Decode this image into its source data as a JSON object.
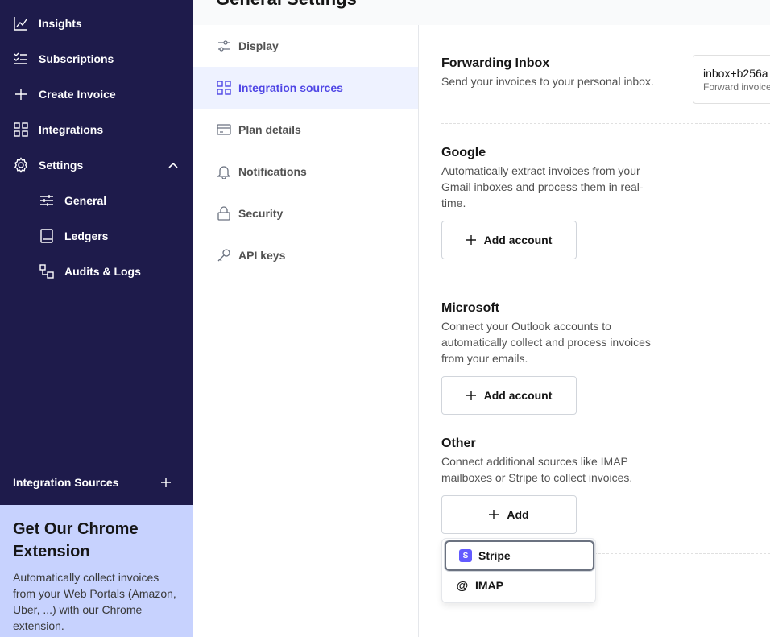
{
  "sidebar": {
    "nav": [
      {
        "label": "Insights",
        "icon": "chart-line-icon"
      },
      {
        "label": "Subscriptions",
        "icon": "checklist-icon"
      },
      {
        "label": "Create Invoice",
        "icon": "plus-icon"
      },
      {
        "label": "Integrations",
        "icon": "grid-icon"
      },
      {
        "label": "Settings",
        "icon": "gear-icon"
      }
    ],
    "settings_sub": [
      {
        "label": "General",
        "icon": "sliders-icon"
      },
      {
        "label": "Ledgers",
        "icon": "book-icon"
      },
      {
        "label": "Audits & Logs",
        "icon": "flow-icon"
      }
    ],
    "integration_sources_label": "Integration Sources",
    "promo": {
      "title": "Get Our Chrome Extension",
      "body": "Automatically collect invoices from your Web Portals (Amazon, Uber, ...) with our Chrome extension."
    }
  },
  "header": {
    "title": "General Settings"
  },
  "settings_menu": [
    {
      "label": "Display",
      "icon": "sliders-icon"
    },
    {
      "label": "Integration sources",
      "icon": "grid-icon"
    },
    {
      "label": "Plan details",
      "icon": "credit-card-icon"
    },
    {
      "label": "Notifications",
      "icon": "bell-icon"
    },
    {
      "label": "Security",
      "icon": "lock-icon"
    },
    {
      "label": "API keys",
      "icon": "key-icon"
    }
  ],
  "sections": {
    "forwarding": {
      "title": "Forwarding Inbox",
      "desc": "Send your invoices to your personal inbox.",
      "address": "inbox+b256a",
      "hint": "Forward invoice"
    },
    "google": {
      "title": "Google",
      "desc": "Automatically extract invoices from your Gmail inboxes and process them in real-time.",
      "button": "Add account"
    },
    "microsoft": {
      "title": "Microsoft",
      "desc": "Connect your Outlook accounts to automatically collect and process invoices from your emails.",
      "button": "Add account"
    },
    "other": {
      "title": "Other",
      "desc": "Connect additional sources like IMAP mailboxes or Stripe to collect invoices.",
      "button": "Add",
      "options": [
        "Stripe",
        "IMAP"
      ]
    }
  },
  "colors": {
    "sidebar_bg": "#1e1b4b",
    "accent": "#4f46e5",
    "promo_bg": "#c7d2fe",
    "stripe": "#635bff"
  }
}
